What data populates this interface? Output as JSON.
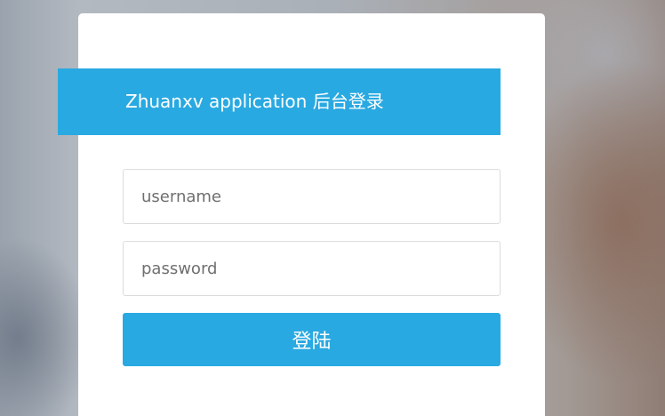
{
  "login": {
    "title": "Zhuanxv application 后台登录",
    "username": {
      "placeholder": "username",
      "value": ""
    },
    "password": {
      "placeholder": "password",
      "value": ""
    },
    "submit_label": "登陆"
  },
  "colors": {
    "accent": "#29a9e1",
    "card_background": "#ffffff",
    "input_border": "#dcdcdc",
    "placeholder_text": "#6f6f6f"
  }
}
